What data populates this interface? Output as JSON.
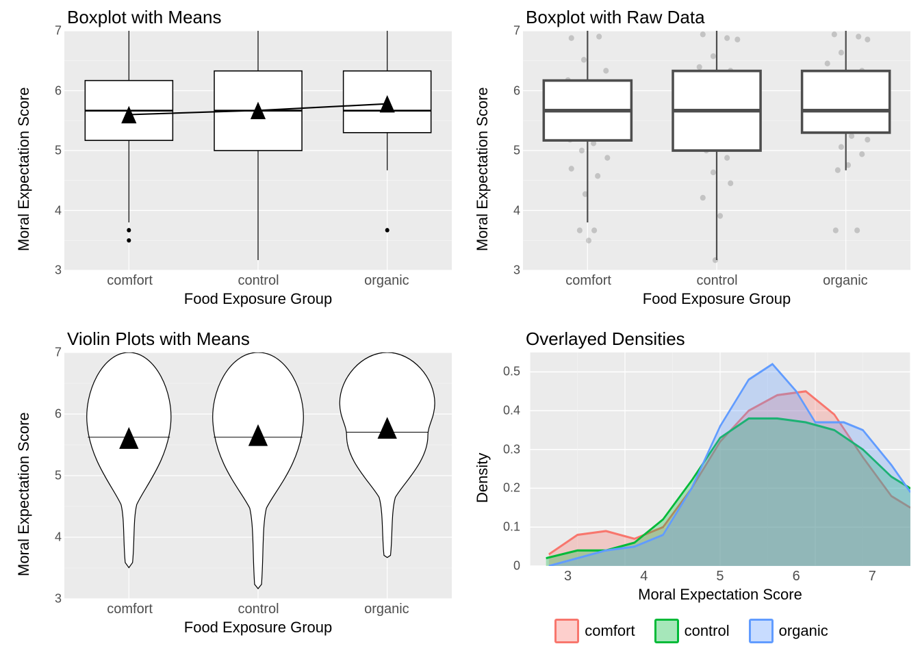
{
  "chart_data": [
    {
      "id": "panel_tl",
      "type": "box",
      "title": "Boxplot with Means",
      "xlabel": "Food Exposure Group",
      "ylabel": "Moral Expectation Score",
      "categories": [
        "comfort",
        "control",
        "organic"
      ],
      "ylim": [
        3,
        7
      ],
      "yticks": [
        3,
        4,
        5,
        6,
        7
      ],
      "series": [
        {
          "name": "comfort",
          "min": 3.8,
          "q1": 5.17,
          "median": 5.67,
          "q3": 6.17,
          "max": 7.0,
          "mean": 5.6,
          "outliers": [
            3.5,
            3.67
          ]
        },
        {
          "name": "control",
          "min": 3.17,
          "q1": 5.0,
          "median": 5.67,
          "q3": 6.33,
          "max": 7.0,
          "mean": 5.67,
          "outliers": []
        },
        {
          "name": "organic",
          "min": 4.67,
          "q1": 5.3,
          "median": 5.67,
          "q3": 6.33,
          "max": 7.0,
          "mean": 5.78,
          "outliers": [
            3.67
          ]
        }
      ],
      "mean_line": true
    },
    {
      "id": "panel_tr",
      "type": "box",
      "title": "Boxplot with Raw Data",
      "xlabel": "Food Exposure Group",
      "ylabel": "Moral Expectation Score",
      "categories": [
        "comfort",
        "control",
        "organic"
      ],
      "ylim": [
        3,
        7
      ],
      "yticks": [
        3,
        4,
        5,
        6,
        7
      ],
      "series": [
        {
          "name": "comfort",
          "min": 3.8,
          "q1": 5.17,
          "median": 5.67,
          "q3": 6.17,
          "max": 7.0,
          "outliers": [
            3.5,
            3.67
          ]
        },
        {
          "name": "control",
          "min": 3.17,
          "q1": 5.0,
          "median": 5.67,
          "q3": 6.33,
          "max": 7.0,
          "outliers": []
        },
        {
          "name": "organic",
          "min": 4.67,
          "q1": 5.3,
          "median": 5.67,
          "q3": 6.33,
          "max": 7.0,
          "outliers": [
            3.67
          ]
        }
      ],
      "show_jitter": true
    },
    {
      "id": "panel_bl",
      "type": "violin",
      "title": "Violin Plots with Means",
      "xlabel": "Food Exposure Group",
      "ylabel": "Moral Expectation Score",
      "categories": [
        "comfort",
        "control",
        "organic"
      ],
      "ylim": [
        3,
        7
      ],
      "yticks": [
        3,
        4,
        5,
        6,
        7
      ],
      "series": [
        {
          "name": "comfort",
          "median": 5.62,
          "mean": 5.6,
          "range": [
            3.5,
            7.0
          ]
        },
        {
          "name": "control",
          "median": 5.62,
          "mean": 5.67,
          "range": [
            3.17,
            7.0
          ]
        },
        {
          "name": "organic",
          "median": 5.7,
          "mean": 5.78,
          "range": [
            3.67,
            7.0
          ]
        }
      ]
    },
    {
      "id": "panel_br",
      "type": "density",
      "title": "Overlayed Densities",
      "xlabel": "Moral Expectation Score",
      "ylabel": "Density",
      "xlim": [
        3,
        7
      ],
      "ylim": [
        0.0,
        0.55
      ],
      "xticks": [
        3,
        4,
        5,
        6,
        7
      ],
      "yticks": [
        0.0,
        0.1,
        0.2,
        0.3,
        0.4,
        0.5
      ],
      "series": [
        {
          "name": "comfort",
          "color": "#F8766D",
          "points": [
            [
              3.2,
              0.03
            ],
            [
              3.5,
              0.08
            ],
            [
              3.8,
              0.09
            ],
            [
              4.1,
              0.07
            ],
            [
              4.4,
              0.1
            ],
            [
              4.7,
              0.2
            ],
            [
              5.0,
              0.32
            ],
            [
              5.3,
              0.4
            ],
            [
              5.6,
              0.44
            ],
            [
              5.9,
              0.45
            ],
            [
              6.2,
              0.39
            ],
            [
              6.5,
              0.28
            ],
            [
              6.8,
              0.18
            ],
            [
              7.0,
              0.15
            ]
          ]
        },
        {
          "name": "control",
          "color": "#00BA38",
          "points": [
            [
              3.17,
              0.02
            ],
            [
              3.5,
              0.04
            ],
            [
              3.8,
              0.04
            ],
            [
              4.1,
              0.06
            ],
            [
              4.4,
              0.12
            ],
            [
              4.7,
              0.22
            ],
            [
              5.0,
              0.33
            ],
            [
              5.3,
              0.38
            ],
            [
              5.6,
              0.38
            ],
            [
              5.9,
              0.37
            ],
            [
              6.2,
              0.35
            ],
            [
              6.5,
              0.3
            ],
            [
              6.8,
              0.23
            ],
            [
              7.0,
              0.2
            ]
          ]
        },
        {
          "name": "organic",
          "color": "#619CFF",
          "points": [
            [
              3.2,
              0.0
            ],
            [
              3.5,
              0.02
            ],
            [
              3.8,
              0.04
            ],
            [
              4.1,
              0.05
            ],
            [
              4.4,
              0.08
            ],
            [
              4.7,
              0.2
            ],
            [
              5.0,
              0.36
            ],
            [
              5.3,
              0.48
            ],
            [
              5.55,
              0.52
            ],
            [
              5.8,
              0.45
            ],
            [
              6.0,
              0.37
            ],
            [
              6.3,
              0.37
            ],
            [
              6.5,
              0.35
            ],
            [
              6.8,
              0.26
            ],
            [
              7.0,
              0.19
            ]
          ]
        }
      ],
      "legend": [
        {
          "label": "comfort",
          "color": "#F8766D"
        },
        {
          "label": "control",
          "color": "#00BA38"
        },
        {
          "label": "organic",
          "color": "#619CFF"
        }
      ]
    }
  ]
}
